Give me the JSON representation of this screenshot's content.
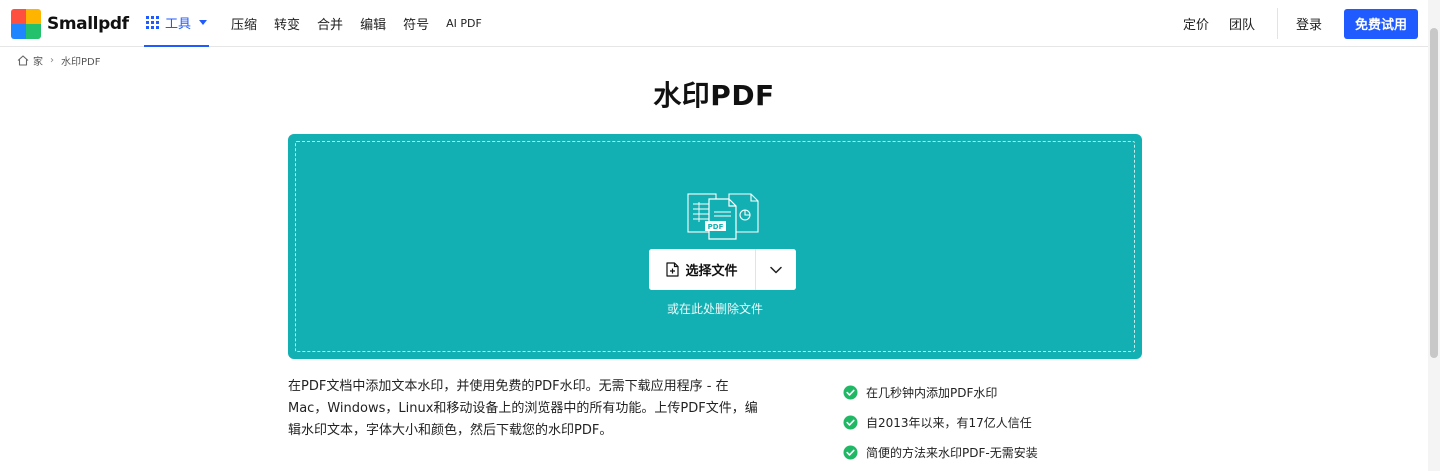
{
  "brand": {
    "name": "Smallpdf"
  },
  "nav": {
    "tools_label": "工具",
    "items": [
      "压缩",
      "转变",
      "合并",
      "编辑",
      "符号",
      "AI PDF"
    ]
  },
  "right_nav": {
    "pricing": "定价",
    "team": "团队",
    "login": "登录",
    "cta": "免费试用"
  },
  "breadcrumb": {
    "home": "家",
    "current": "水印PDF"
  },
  "page": {
    "title": "水印PDF"
  },
  "dropzone": {
    "choose_label": "选择文件",
    "hint": "或在此处删除文件",
    "illustration_badge": "PDF"
  },
  "description": "在PDF文档中添加文本水印，并使用免费的PDF水印。无需下载应用程序 - 在Mac，Windows，Linux和移动设备上的浏览器中的所有功能。上传PDF文件，编辑水印文本，字体大小和颜色，然后下载您的水印PDF。",
  "features": [
    "在几秒钟内添加PDF水印",
    "自2013年以来，有17亿人信任",
    "简便的方法来水印PDF-无需安装"
  ],
  "colors": {
    "accent": "#1f5bff",
    "dropzone": "#12b0b3",
    "check": "#1fb864"
  }
}
